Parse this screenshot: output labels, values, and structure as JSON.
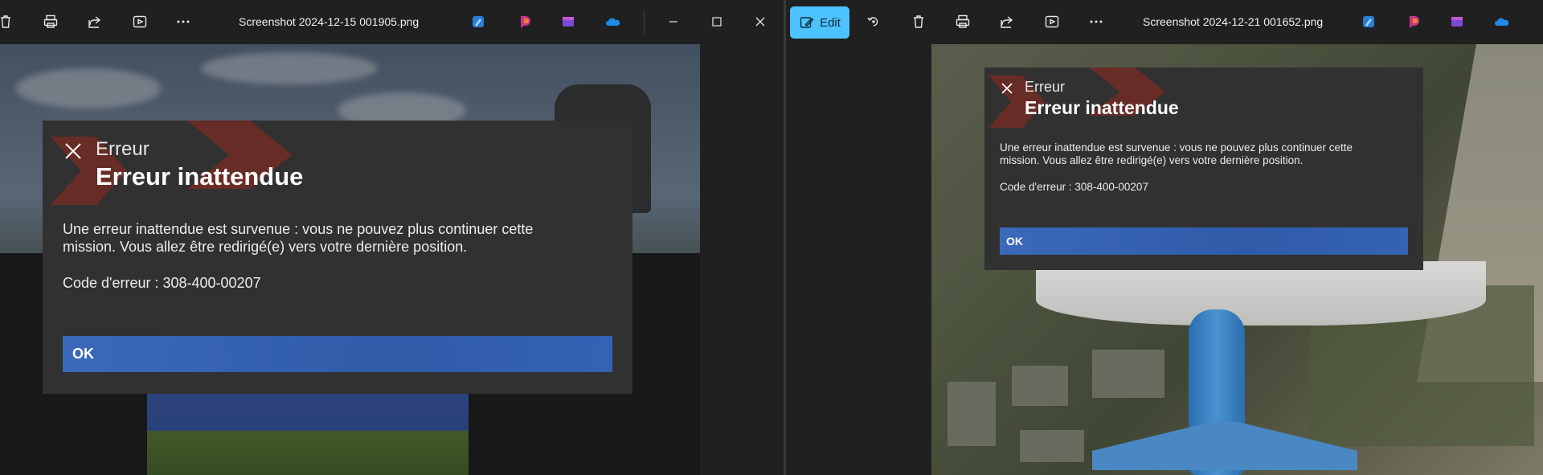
{
  "left_window": {
    "title": "Screenshot 2024-12-15 001905.png",
    "dialog": {
      "small_title": "Erreur",
      "title": "Erreur inattendue",
      "message": "Une erreur inattendue est survenue : vous ne pouvez plus continuer cette mission. Vous allez être redirigé(e) vers votre dernière position.",
      "code": "Code d'erreur : 308-400-00207",
      "ok_label": "OK"
    }
  },
  "right_window": {
    "title": "Screenshot 2024-12-21 001652.png",
    "edit_label": "Edit",
    "dialog": {
      "small_title": "Erreur",
      "title": "Erreur inattendue",
      "message": "Une erreur inattendue est survenue : vous ne pouvez plus continuer cette mission. Vous allez être redirigé(e) vers votre dernière position.",
      "code": "Code d'erreur : 308-400-00207",
      "ok_label": "OK"
    }
  },
  "icons": [
    "delete-icon",
    "print-icon",
    "share-icon",
    "slideshow-icon",
    "more-icon",
    "designer-icon",
    "clipchamp-icon",
    "photos-icon",
    "onedrive-icon",
    "minimize-icon",
    "maximize-icon",
    "close-icon",
    "edit-icon",
    "rotate-icon"
  ],
  "colors": {
    "accent": "#4cc2ff",
    "ok_button": "#2f5ba8",
    "dialog_bg": "#313131",
    "toolbar_bg": "#202020"
  }
}
